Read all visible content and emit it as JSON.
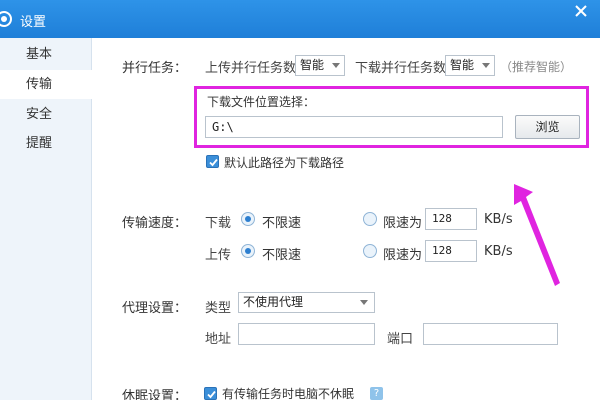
{
  "window": {
    "title": "设置"
  },
  "sidebar": {
    "items": [
      {
        "label": "基本"
      },
      {
        "label": "传输"
      },
      {
        "label": "安全"
      },
      {
        "label": "提醒"
      }
    ]
  },
  "parallel": {
    "label": "并行任务：",
    "upload_label": "上传并行任务数",
    "upload_value": "智能",
    "download_label": "下载并行任务数",
    "download_value": "智能",
    "recommend": "（推荐智能）"
  },
  "download_location": {
    "label": "下载文件位置选择：",
    "path": "G:\\",
    "browse": "浏览",
    "default_checkbox": "默认此路径为下载路径"
  },
  "speed": {
    "label": "传输速度：",
    "download": {
      "label": "下载",
      "unlimited": "不限速",
      "limit": "限速为",
      "value": "128",
      "unit": "KB/s"
    },
    "upload": {
      "label": "上传",
      "unlimited": "不限速",
      "limit": "限速为",
      "value": "128",
      "unit": "KB/s"
    }
  },
  "proxy": {
    "label": "代理设置：",
    "type_label": "类型",
    "type_value": "不使用代理",
    "address_label": "地址",
    "address_value": "",
    "port_label": "端口",
    "port_value": ""
  },
  "sleep": {
    "label": "休眠设置：",
    "checkbox": "有传输任务时电脑不休眠",
    "help": "?"
  },
  "colors": {
    "titlebar": "#1f7fd8",
    "highlight": "#e024e0",
    "arrow": "#e024e0"
  }
}
